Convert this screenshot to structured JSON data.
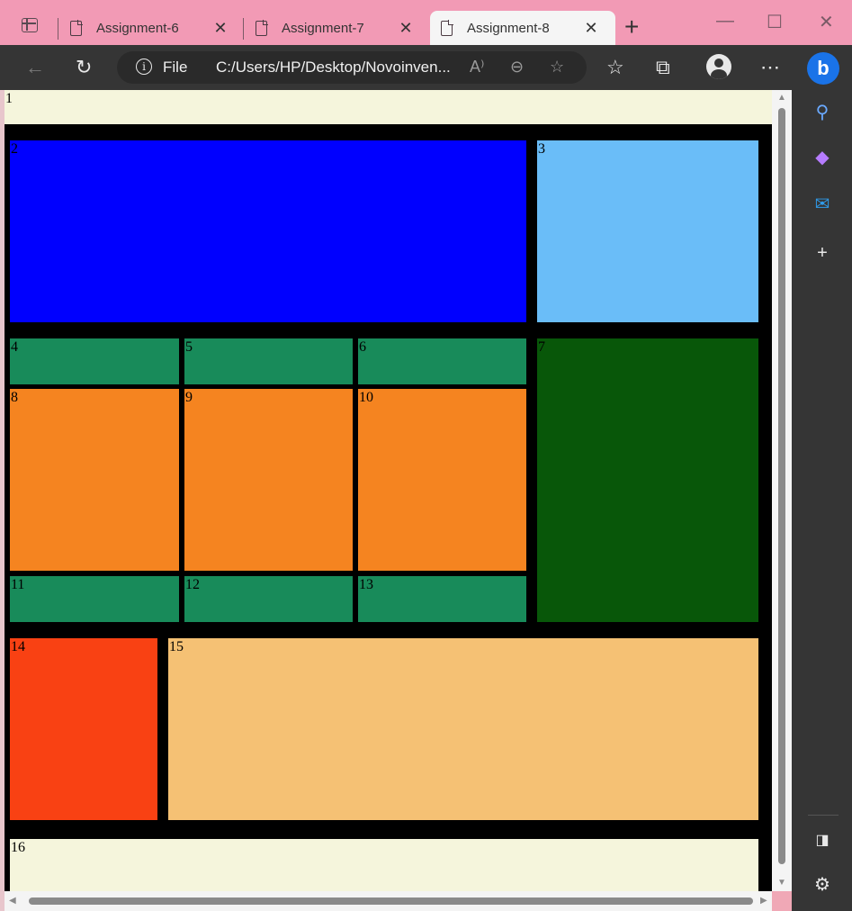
{
  "browser": {
    "tabs": [
      {
        "label": "Assignment-6",
        "active": false
      },
      {
        "label": "Assignment-7",
        "active": false
      },
      {
        "label": "Assignment-8",
        "active": true
      }
    ],
    "address": {
      "scheme": "File",
      "url": "C:/Users/HP/Desktop/Novoinven..."
    },
    "icons": {
      "tab_actions": "tab-actions-icon",
      "back": "back-arrow-icon",
      "refresh": "refresh-icon",
      "info": "info-icon",
      "read_aloud": "read-aloud-icon",
      "zoom_out": "zoom-out-icon",
      "favorite_add": "add-favorite-icon",
      "favorites": "favorites-icon",
      "collections": "collections-icon",
      "profile": "profile-icon",
      "more": "more-icon",
      "bing": "bing-icon"
    },
    "window_controls": {
      "minimize": "—",
      "maximize": "☐",
      "close": "✕"
    },
    "sidebar": [
      "search-icon",
      "copilot-icon",
      "outlook-icon",
      "add-icon"
    ]
  },
  "page": {
    "boxes": [
      {
        "label": "1",
        "color": "#f5f5dc"
      },
      {
        "label": "2",
        "color": "#0000ff"
      },
      {
        "label": "3",
        "color": "#6abdf8"
      },
      {
        "label": "4",
        "color": "#188b5a"
      },
      {
        "label": "5",
        "color": "#188b5a"
      },
      {
        "label": "6",
        "color": "#188b5a"
      },
      {
        "label": "7",
        "color": "#085709"
      },
      {
        "label": "8",
        "color": "#f58420"
      },
      {
        "label": "9",
        "color": "#f58420"
      },
      {
        "label": "10",
        "color": "#f58420"
      },
      {
        "label": "11",
        "color": "#188b5a"
      },
      {
        "label": "12",
        "color": "#188b5a"
      },
      {
        "label": "13",
        "color": "#188b5a"
      },
      {
        "label": "14",
        "color": "#f94113"
      },
      {
        "label": "15",
        "color": "#f5c174"
      },
      {
        "label": "16",
        "color": "#f5f5dc"
      }
    ]
  }
}
